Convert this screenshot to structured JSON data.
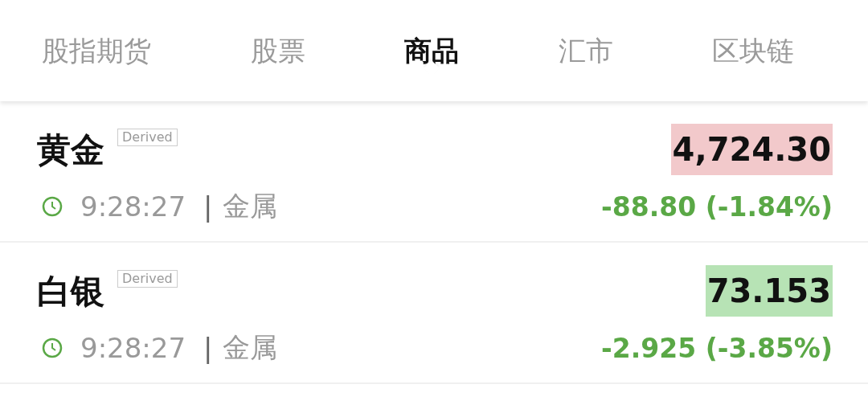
{
  "tabs": [
    {
      "label": "股指期货",
      "selected": false
    },
    {
      "label": "股票",
      "selected": false
    },
    {
      "label": "商品",
      "selected": true
    },
    {
      "label": "汇市",
      "selected": false
    },
    {
      "label": "区块链",
      "selected": false
    }
  ],
  "quotes": [
    {
      "name": "黄金",
      "badge": "Derived",
      "time": "9:28:27",
      "separator": "|",
      "category": "金属",
      "price": "4,724.30",
      "color": "#f2c9cb",
      "change": "-88.80 (-1.84%)"
    },
    {
      "name": "白银",
      "badge": "Derived",
      "time": "9:28:27",
      "separator": "|",
      "category": "金属",
      "price": "73.153",
      "color": "#b7e3b5",
      "change": "-2.925 (-3.85%)"
    }
  ]
}
